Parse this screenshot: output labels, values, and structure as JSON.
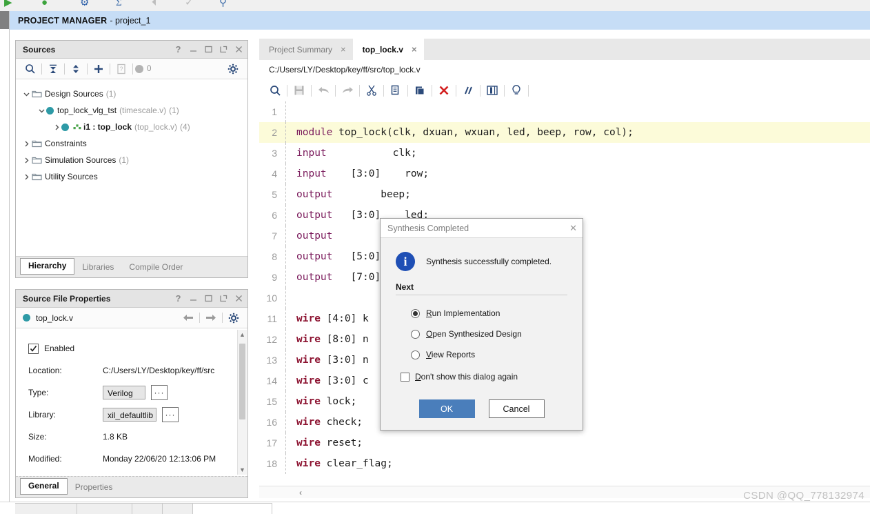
{
  "top_toolbar": {
    "icons": [
      "green-arrow-icon",
      "green-play-icon",
      "blue-gear-icon",
      "sigma-icon",
      "flag-icon",
      "checkmark-flag-icon",
      "wrench-icon"
    ]
  },
  "header": {
    "title_bold": "PROJECT MANAGER",
    "title_rest": "- project_1"
  },
  "sources": {
    "title": "Sources",
    "panel_buttons": [
      "help-icon",
      "minimize-icon",
      "maximize-icon",
      "float-icon",
      "close-icon"
    ],
    "toolbar": {
      "search": "search-icon",
      "collapse_all": "collapse-all-icon",
      "expand_collapse": "expand-collapse-icon",
      "add": "add-sources-icon",
      "file": "file-icon",
      "count": "0",
      "settings": "gear-icon"
    },
    "tree": [
      {
        "label": "Design Sources",
        "suffix": "(1)",
        "dim": "",
        "depth": 0,
        "twist": "down",
        "kind": "folder",
        "bold": false
      },
      {
        "label": "top_lock_vlg_tst",
        "suffix": "(1)",
        "dim": "(timescale.v)",
        "depth": 1,
        "twist": "down",
        "kind": "module",
        "bold": false
      },
      {
        "label": "i1 : top_lock",
        "suffix": "(4)",
        "dim": "(top_lock.v)",
        "depth": 2,
        "twist": "right",
        "kind": "instance",
        "bold": true
      },
      {
        "label": "Constraints",
        "suffix": "",
        "dim": "",
        "depth": 0,
        "twist": "right",
        "kind": "folder",
        "bold": false
      },
      {
        "label": "Simulation Sources",
        "suffix": "(1)",
        "dim": "",
        "depth": 0,
        "twist": "right",
        "kind": "folder",
        "bold": false
      },
      {
        "label": "Utility Sources",
        "suffix": "",
        "dim": "",
        "depth": 0,
        "twist": "right",
        "kind": "folder",
        "bold": false
      }
    ],
    "tabs": [
      {
        "label": "Hierarchy",
        "active": true
      },
      {
        "label": "Libraries",
        "active": false
      },
      {
        "label": "Compile Order",
        "active": false
      }
    ]
  },
  "source_file_properties": {
    "title": "Source File Properties",
    "panel_buttons": [
      "help-icon",
      "minimize-icon",
      "maximize-icon",
      "float-icon",
      "close-icon"
    ],
    "file_name": "top_lock.v",
    "nav": [
      "back-arrow-icon",
      "forward-arrow-icon",
      "gear-icon"
    ],
    "enabled_label": "Enabled",
    "enabled_checked": true,
    "rows": [
      {
        "label": "Location:",
        "value": "C:/Users/LY/Desktop/key/ff/src",
        "field": false,
        "ellipsis": false
      },
      {
        "label": "Type:",
        "value": "Verilog",
        "field": true,
        "ellipsis": true
      },
      {
        "label": "Library:",
        "value": "xil_defaultlib",
        "field": true,
        "ellipsis": true
      },
      {
        "label": "Size:",
        "value": "1.8 KB",
        "field": false,
        "ellipsis": false
      },
      {
        "label": "Modified:",
        "value": "Monday 22/06/20 12:13:06 PM",
        "field": false,
        "ellipsis": false
      }
    ],
    "ellipsis_label": "···",
    "tabs": [
      {
        "label": "General",
        "active": true
      },
      {
        "label": "Properties",
        "active": false
      }
    ]
  },
  "editor": {
    "tabs": [
      {
        "label": "Project Summary",
        "active": false
      },
      {
        "label": "top_lock.v",
        "active": true
      }
    ],
    "close_glyph": "×",
    "file_path": "C:/Users/LY/Desktop/key/ff/src/top_lock.v",
    "toolbar_icons": [
      "search-icon",
      "save-icon",
      "undo-icon",
      "redo-icon",
      "cut-icon",
      "copy-icon",
      "paste-icon",
      "delete-icon",
      "comment-icon",
      "columns-icon",
      "hint-icon"
    ],
    "lines": [
      {
        "n": "1",
        "text": "",
        "highlight": false
      },
      {
        "n": "2",
        "text": "module top_lock(clk, dxuan, wxuan, led, beep, row, col);",
        "highlight": true,
        "kw": "module"
      },
      {
        "n": "3",
        "text": "input           clk;",
        "highlight": false,
        "kw": "input"
      },
      {
        "n": "4",
        "text": "input    [3:0]    row;",
        "highlight": false,
        "kw": "input"
      },
      {
        "n": "5",
        "text": "output         beep;",
        "highlight": false,
        "kw": "output"
      },
      {
        "n": "6",
        "text": "output   [3:0]    led;",
        "highlight": false,
        "kw": "output"
      },
      {
        "n": "7",
        "text": "output",
        "highlight": false,
        "kw": "output"
      },
      {
        "n": "8",
        "text": "output   [5:0]",
        "highlight": false,
        "kw": "output"
      },
      {
        "n": "9",
        "text": "output   [7:0]",
        "highlight": false,
        "kw": "output"
      },
      {
        "n": "10",
        "text": "",
        "highlight": false
      },
      {
        "n": "11",
        "text": "wire [4:0] k",
        "highlight": false,
        "kw2": "wire"
      },
      {
        "n": "12",
        "text": "wire [8:0] n",
        "highlight": false,
        "kw2": "wire"
      },
      {
        "n": "13",
        "text": "wire [3:0] n",
        "highlight": false,
        "kw2": "wire"
      },
      {
        "n": "14",
        "text": "wire [3:0] c",
        "highlight": false,
        "kw2": "wire"
      },
      {
        "n": "15",
        "text": "wire lock;",
        "highlight": false,
        "kw2": "wire"
      },
      {
        "n": "16",
        "text": "wire check;",
        "highlight": false,
        "kw2": "wire"
      },
      {
        "n": "17",
        "text": "wire reset;",
        "highlight": false,
        "kw2": "wire"
      },
      {
        "n": "18",
        "text": "wire clear_flag;",
        "highlight": false,
        "kw2": "wire"
      }
    ],
    "scroll_left_glyph": "‹"
  },
  "dialog": {
    "title": "Synthesis Completed",
    "close_glyph": "✕",
    "info_glyph": "i",
    "message": "Synthesis successfully completed.",
    "next_heading": "Next",
    "options": [
      {
        "pre": "",
        "mnemonic": "R",
        "post": "un Implementation",
        "selected": true
      },
      {
        "pre": "",
        "mnemonic": "O",
        "post": "pen Synthesized Design",
        "selected": false
      },
      {
        "pre": "",
        "mnemonic": "V",
        "post": "iew Reports",
        "selected": false
      }
    ],
    "dont_show": {
      "mnemonic": "D",
      "post": "on't show this dialog again",
      "checked": false
    },
    "ok_label": "OK",
    "cancel_label": "Cancel"
  },
  "watermark": "CSDN @QQ_778132974",
  "colors": {
    "header_blue": "#c6ddf6",
    "accent_blue": "#2b4a7a",
    "primary_button": "#4a7ebb",
    "info_blue": "#1f4fb5",
    "highlight_yellow": "#fcfbd9",
    "teal_node": "#2e9aa6",
    "delete_red": "#d32020"
  }
}
